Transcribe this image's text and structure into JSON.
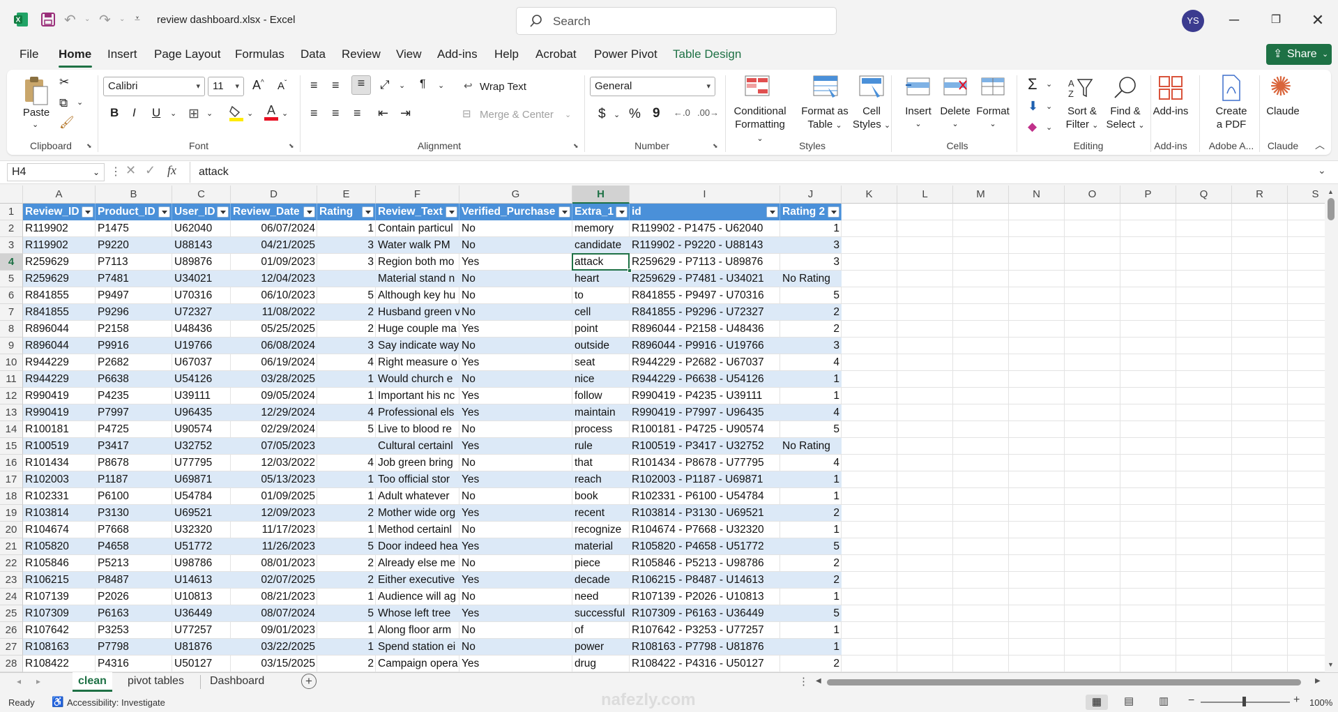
{
  "app": {
    "filename": "review dashboard.xlsx",
    "sep": "-",
    "appname": "Excel",
    "search_placeholder": "Search",
    "user_initials": "YS",
    "share_label": "Share"
  },
  "tabs": [
    "File",
    "Home",
    "Insert",
    "Page Layout",
    "Formulas",
    "Data",
    "Review",
    "View",
    "Add-ins",
    "Help",
    "Acrobat",
    "Power Pivot",
    "Table Design"
  ],
  "ribbon": {
    "clipboard": {
      "paste": "Paste",
      "group": "Clipboard"
    },
    "font": {
      "name": "Calibri",
      "size": "11",
      "group": "Font"
    },
    "alignment": {
      "wrap": "Wrap Text",
      "merge": "Merge & Center",
      "group": "Alignment"
    },
    "number": {
      "format": "General",
      "dollar": "$",
      "percent": "%",
      "comma": "9",
      "group": "Number"
    },
    "styles": {
      "cond1": "Conditional",
      "cond2": "Formatting",
      "fmt1": "Format as",
      "fmt2": "Table",
      "cell1": "Cell",
      "cell2": "Styles",
      "group": "Styles"
    },
    "cells": {
      "insert": "Insert",
      "delete": "Delete",
      "format": "Format",
      "group": "Cells"
    },
    "editing": {
      "sigma": "Σ",
      "sort1": "Sort &",
      "sort2": "Filter",
      "find1": "Find &",
      "find2": "Select",
      "group": "Editing"
    },
    "addins": {
      "label": "Add-ins",
      "group": "Add-ins"
    },
    "adobe": {
      "l1": "Create",
      "l2": "a PDF",
      "group": "Adobe A..."
    },
    "claude": {
      "label": "Claude",
      "group": "Claude"
    }
  },
  "formula_bar": {
    "name_box": "H4",
    "fx": "fx",
    "content": "attack"
  },
  "columns": [
    "A",
    "B",
    "C",
    "D",
    "E",
    "F",
    "G",
    "H",
    "I",
    "J",
    "K",
    "L",
    "M",
    "N",
    "O",
    "P",
    "Q",
    "R",
    "S"
  ],
  "selected_column": "H",
  "selected_row": 4,
  "headers": [
    "Review_ID",
    "Product_ID",
    "User_ID",
    "Review_Date",
    "Rating",
    "Review_Text",
    "Verified_Purchase",
    "Extra_1",
    "id",
    "Rating 2"
  ],
  "rows": [
    [
      "R119902",
      "P1475",
      "U62040",
      "06/07/2024",
      "1",
      "Contain particul",
      "No",
      "memory",
      "R119902 - P1475 - U62040",
      "1"
    ],
    [
      "R119902",
      "P9220",
      "U88143",
      "04/21/2025",
      "3",
      "Water walk PM",
      "No",
      "candidate",
      "R119902 - P9220 - U88143",
      "3"
    ],
    [
      "R259629",
      "P7113",
      "U89876",
      "01/09/2023",
      "3",
      "Region both mo",
      "Yes",
      "attack",
      "R259629 - P7113 - U89876",
      "3"
    ],
    [
      "R259629",
      "P7481",
      "U34021",
      "12/04/2023",
      "",
      "Material stand n",
      "No",
      "heart",
      "R259629 - P7481 - U34021",
      "No Rating"
    ],
    [
      "R841855",
      "P9497",
      "U70316",
      "06/10/2023",
      "5",
      "Although key hu",
      "No",
      "to",
      "R841855 - P9497 - U70316",
      "5"
    ],
    [
      "R841855",
      "P9296",
      "U72327",
      "11/08/2022",
      "2",
      "Husband green v",
      "No",
      "cell",
      "R841855 - P9296 - U72327",
      "2"
    ],
    [
      "R896044",
      "P2158",
      "U48436",
      "05/25/2025",
      "2",
      "Huge couple ma",
      "Yes",
      "point",
      "R896044 - P2158 - U48436",
      "2"
    ],
    [
      "R896044",
      "P9916",
      "U19766",
      "06/08/2024",
      "3",
      "Say indicate way",
      "No",
      "outside",
      "R896044 - P9916 - U19766",
      "3"
    ],
    [
      "R944229",
      "P2682",
      "U67037",
      "06/19/2024",
      "4",
      "Right measure o",
      "Yes",
      "seat",
      "R944229 - P2682 - U67037",
      "4"
    ],
    [
      "R944229",
      "P6638",
      "U54126",
      "03/28/2025",
      "1",
      "Would church e",
      "No",
      "nice",
      "R944229 - P6638 - U54126",
      "1"
    ],
    [
      "R990419",
      "P4235",
      "U39111",
      "09/05/2024",
      "1",
      "Important his nc",
      "Yes",
      "follow",
      "R990419 - P4235 - U39111",
      "1"
    ],
    [
      "R990419",
      "P7997",
      "U96435",
      "12/29/2024",
      "4",
      "Professional els",
      "Yes",
      "maintain",
      "R990419 - P7997 - U96435",
      "4"
    ],
    [
      "R100181",
      "P4725",
      "U90574",
      "02/29/2024",
      "5",
      "Live to blood re",
      "No",
      "process",
      "R100181 - P4725 - U90574",
      "5"
    ],
    [
      "R100519",
      "P3417",
      "U32752",
      "07/05/2023",
      "",
      "Cultural certainl",
      "Yes",
      "rule",
      "R100519 - P3417 - U32752",
      "No Rating"
    ],
    [
      "R101434",
      "P8678",
      "U77795",
      "12/03/2022",
      "4",
      "Job green bring",
      "No",
      "that",
      "R101434 - P8678 - U77795",
      "4"
    ],
    [
      "R102003",
      "P1187",
      "U69871",
      "05/13/2023",
      "1",
      "Too official stor",
      "Yes",
      "reach",
      "R102003 - P1187 - U69871",
      "1"
    ],
    [
      "R102331",
      "P6100",
      "U54784",
      "01/09/2025",
      "1",
      "Adult whatever",
      "No",
      "book",
      "R102331 - P6100 - U54784",
      "1"
    ],
    [
      "R103814",
      "P3130",
      "U69521",
      "12/09/2023",
      "2",
      "Mother wide org",
      "Yes",
      "recent",
      "R103814 - P3130 - U69521",
      "2"
    ],
    [
      "R104674",
      "P7668",
      "U32320",
      "11/17/2023",
      "1",
      "Method certainl",
      "No",
      "recognize",
      "R104674 - P7668 - U32320",
      "1"
    ],
    [
      "R105820",
      "P4658",
      "U51772",
      "11/26/2023",
      "5",
      "Door indeed hea",
      "Yes",
      "material",
      "R105820 - P4658 - U51772",
      "5"
    ],
    [
      "R105846",
      "P5213",
      "U98786",
      "08/01/2023",
      "2",
      "Already else me",
      "No",
      "piece",
      "R105846 - P5213 - U98786",
      "2"
    ],
    [
      "R106215",
      "P8487",
      "U14613",
      "02/07/2025",
      "2",
      "Either executive",
      "Yes",
      "decade",
      "R106215 - P8487 - U14613",
      "2"
    ],
    [
      "R107139",
      "P2026",
      "U10813",
      "08/21/2023",
      "1",
      "Audience will ag",
      "No",
      "need",
      "R107139 - P2026 - U10813",
      "1"
    ],
    [
      "R107309",
      "P6163",
      "U36449",
      "08/07/2024",
      "5",
      "Whose left tree",
      "Yes",
      "successful",
      "R107309 - P6163 - U36449",
      "5"
    ],
    [
      "R107642",
      "P3253",
      "U77257",
      "09/01/2023",
      "1",
      "Along floor arm",
      "No",
      "of",
      "R107642 - P3253 - U77257",
      "1"
    ],
    [
      "R108163",
      "P7798",
      "U81876",
      "03/22/2025",
      "1",
      "Spend station ei",
      "No",
      "power",
      "R108163 - P7798 - U81876",
      "1"
    ],
    [
      "R108422",
      "P4316",
      "U50127",
      "03/15/2025",
      "2",
      "Campaign opera",
      "Yes",
      "drug",
      "R108422 - P4316 - U50127",
      "2"
    ]
  ],
  "sheets": [
    "clean",
    "pivot tables",
    "Dashboard"
  ],
  "active_sheet": "clean",
  "status": {
    "ready": "Ready",
    "accessibility": "Accessibility: Investigate",
    "zoom": "100%"
  },
  "watermark": "nafezly.com",
  "colors": {
    "excel_green": "#1e7145",
    "table_header": "#4a90d9",
    "band": "#dce9f7"
  }
}
